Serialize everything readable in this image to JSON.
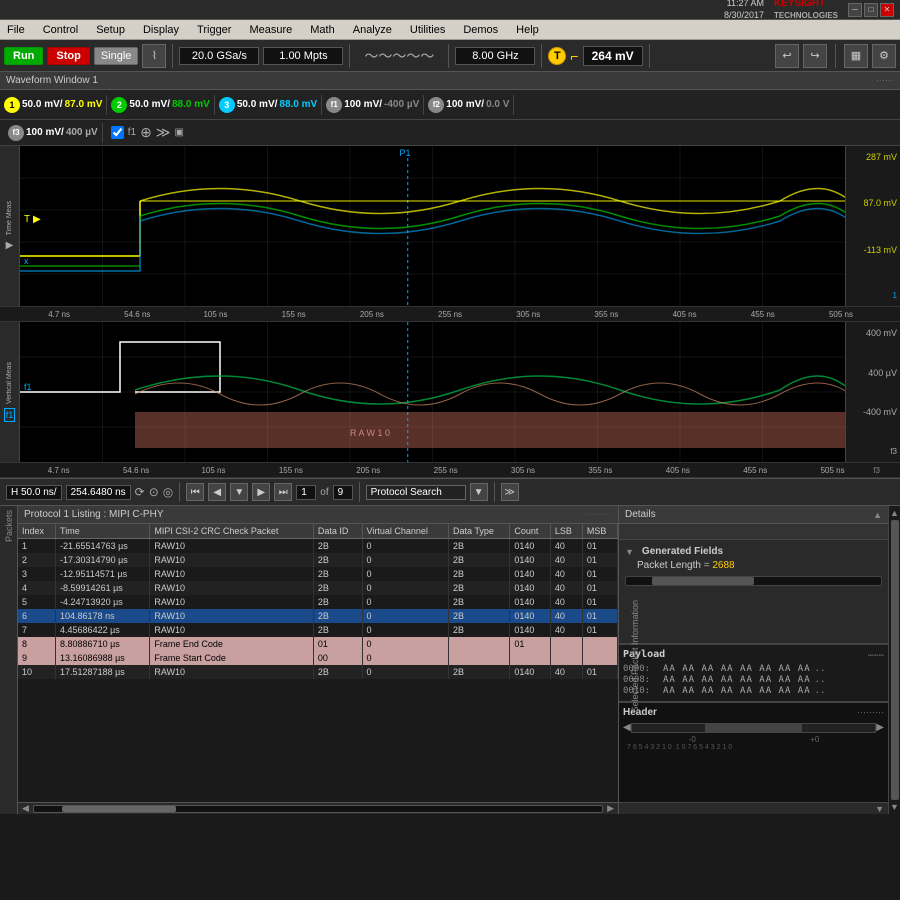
{
  "titlebar": {
    "time": "11:27 AM\n8/30/2017",
    "logo": "KEYSIGHT\nTECHNOLOGIES"
  },
  "menubar": {
    "items": [
      "File",
      "Control",
      "Setup",
      "Display",
      "Trigger",
      "Measure",
      "Math",
      "Analyze",
      "Utilities",
      "Demos",
      "Help"
    ]
  },
  "toolbar": {
    "run": "Run",
    "stop": "Stop",
    "single": "Single",
    "sample_rate": "20.0 GSa/s",
    "memory": "1.00 Mpts",
    "bandwidth": "8.00 GHz",
    "trigger_level": "264 mV"
  },
  "waveform_window": {
    "title": "Waveform Window 1"
  },
  "channels": [
    {
      "num": "1",
      "class": "c1",
      "volt1": "50.0 mV/",
      "volt2": "87.0 mV"
    },
    {
      "num": "2",
      "class": "c2",
      "volt1": "50.0 mV/",
      "volt2": "88.0 mV"
    },
    {
      "num": "3",
      "class": "c3",
      "volt1": "50.0 mV/",
      "volt2": "88.0 mV"
    },
    {
      "num": "f1",
      "class": "cf1",
      "volt1": "100 mV/",
      "volt2": "-400 µV"
    },
    {
      "num": "f2",
      "class": "cf2",
      "volt1": "100 mV/",
      "volt2": "0.0 V"
    }
  ],
  "ch3_row2": {
    "num": "f3",
    "volt1": "100 mV/",
    "volt2": "400 µV"
  },
  "scope_right_upper": {
    "top": "287 mV",
    "mid": "87.0 mV",
    "bot": "-113 mV"
  },
  "scope_right_lower": {
    "top": "400 mV",
    "mid": "400 µV",
    "bot": "-400 mV",
    "label": "f3"
  },
  "time_axis": {
    "ticks": [
      "4.7 ns",
      "54.6 ns",
      "105 ns",
      "155 ns",
      "205 ns",
      "255 ns",
      "305 ns",
      "355 ns",
      "405 ns",
      "455 ns",
      "505 ns"
    ]
  },
  "raw_label": "R A W 1 0",
  "nav": {
    "timebase": "H  50.0 ns/",
    "position": "254.6480 ns",
    "page_current": "1",
    "page_total": "9",
    "search_label": "Protocol Search"
  },
  "proto_listing": {
    "title": "Protocol 1 Listing : MIPI C-PHY",
    "columns": [
      "Index",
      "Time",
      "MIPI CSI-2 CRC Check Packet",
      "Data ID",
      "Virtual Channel",
      "Data Type",
      "Count",
      "LSB",
      "MSB"
    ],
    "rows": [
      {
        "index": "1",
        "time": "-21.65514763 µs",
        "packet": "RAW10",
        "dataid": "2B",
        "vchannel": "0",
        "datatype": "2B",
        "count": "0140",
        "lsb": "40",
        "msb": "01",
        "style": "normal"
      },
      {
        "index": "2",
        "time": "-17.30314790 µs",
        "packet": "RAW10",
        "dataid": "2B",
        "vchannel": "0",
        "datatype": "2B",
        "count": "0140",
        "lsb": "40",
        "msb": "01",
        "style": "normal"
      },
      {
        "index": "3",
        "time": "-12.95114571 µs",
        "packet": "RAW10",
        "dataid": "2B",
        "vchannel": "0",
        "datatype": "2B",
        "count": "0140",
        "lsb": "40",
        "msb": "01",
        "style": "normal"
      },
      {
        "index": "4",
        "time": "-8.59914261 µs",
        "packet": "RAW10",
        "dataid": "2B",
        "vchannel": "0",
        "datatype": "2B",
        "count": "0140",
        "lsb": "40",
        "msb": "01",
        "style": "normal"
      },
      {
        "index": "5",
        "time": "-4.24713920 µs",
        "packet": "RAW10",
        "dataid": "2B",
        "vchannel": "0",
        "datatype": "2B",
        "count": "0140",
        "lsb": "40",
        "msb": "01",
        "style": "normal"
      },
      {
        "index": "6",
        "time": "104.86178 ns",
        "packet": "RAW10",
        "dataid": "2B",
        "vchannel": "0",
        "datatype": "2B",
        "count": "0140",
        "lsb": "40",
        "msb": "01",
        "style": "highlighted"
      },
      {
        "index": "7",
        "time": "4.45686422 µs",
        "packet": "RAW10",
        "dataid": "2B",
        "vchannel": "0",
        "datatype": "2B",
        "count": "0140",
        "lsb": "40",
        "msb": "01",
        "style": "normal"
      },
      {
        "index": "8",
        "time": "8.80886710 µs",
        "packet": "Frame End Code",
        "dataid": "01",
        "vchannel": "0",
        "datatype": "",
        "count": "01",
        "lsb": "",
        "msb": "",
        "style": "pink"
      },
      {
        "index": "9",
        "time": "13.16086988 µs",
        "packet": "Frame Start Code",
        "dataid": "00",
        "vchannel": "0",
        "datatype": "",
        "count": "",
        "lsb": "",
        "msb": "",
        "style": "pink"
      },
      {
        "index": "10",
        "time": "17.51287188 µs",
        "packet": "RAW10",
        "dataid": "2B",
        "vchannel": "0",
        "datatype": "2B",
        "count": "0140",
        "lsb": "40",
        "msb": "01",
        "style": "normal"
      }
    ]
  },
  "right_panel": {
    "header": "Details",
    "selected_label": "Selected Packet Information",
    "generated_fields": {
      "title": "Generated Fields",
      "packet_length_label": "Packet Length",
      "packet_length_value": "2688"
    },
    "payload": {
      "title": "Payload",
      "rows": [
        {
          "addr": "0000:",
          "hex": "AA AA AA AA AA AA AA AA",
          "suffix": ".."
        },
        {
          "addr": "0008:",
          "hex": "AA AA AA AA AA AA AA AA",
          "suffix": ".."
        },
        {
          "addr": "0010:",
          "hex": "AA AA AA AA AA AA AA AA",
          "suffix": ".."
        }
      ]
    },
    "header_section": {
      "title": "Header"
    }
  },
  "p1_marker": "P1"
}
